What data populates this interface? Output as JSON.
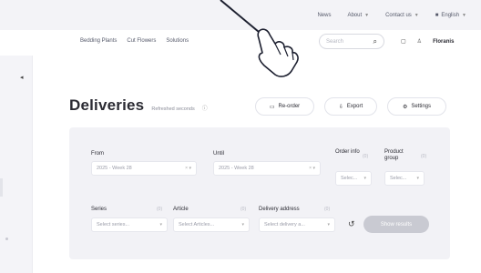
{
  "topbar": {
    "items": [
      {
        "label": "News",
        "chevron": false
      },
      {
        "label": "About",
        "chevron": true
      },
      {
        "label": "Contact us",
        "chevron": true
      },
      {
        "label": "English",
        "chevron": true
      }
    ]
  },
  "nav": {
    "links": [
      "Bedding Plants",
      "Cut Flowers",
      "Solutions"
    ],
    "search_placeholder": "Search",
    "icon_labels": {
      "user": "Floranis"
    }
  },
  "page": {
    "title": "Deliveries",
    "subtitle": "Refreshed seconds",
    "actions": {
      "reorder": "Re-order",
      "export": "Export",
      "settings": "Settings"
    }
  },
  "filters": {
    "from": {
      "label": "From",
      "value": "2025 - Week 28"
    },
    "until": {
      "label": "Until",
      "value": "2025 - Week 28"
    },
    "order_info": {
      "label": "Order info",
      "value": "Selec..."
    },
    "product_group": {
      "label": "Product group",
      "value": "Selec..."
    },
    "series": {
      "label": "Series",
      "value": "Select series..."
    },
    "article": {
      "label": "Article",
      "value": "Select Articles..."
    },
    "delivery_address": {
      "label": "Delivery address",
      "value": "Select delivery a..."
    },
    "show_results": "Show results"
  }
}
